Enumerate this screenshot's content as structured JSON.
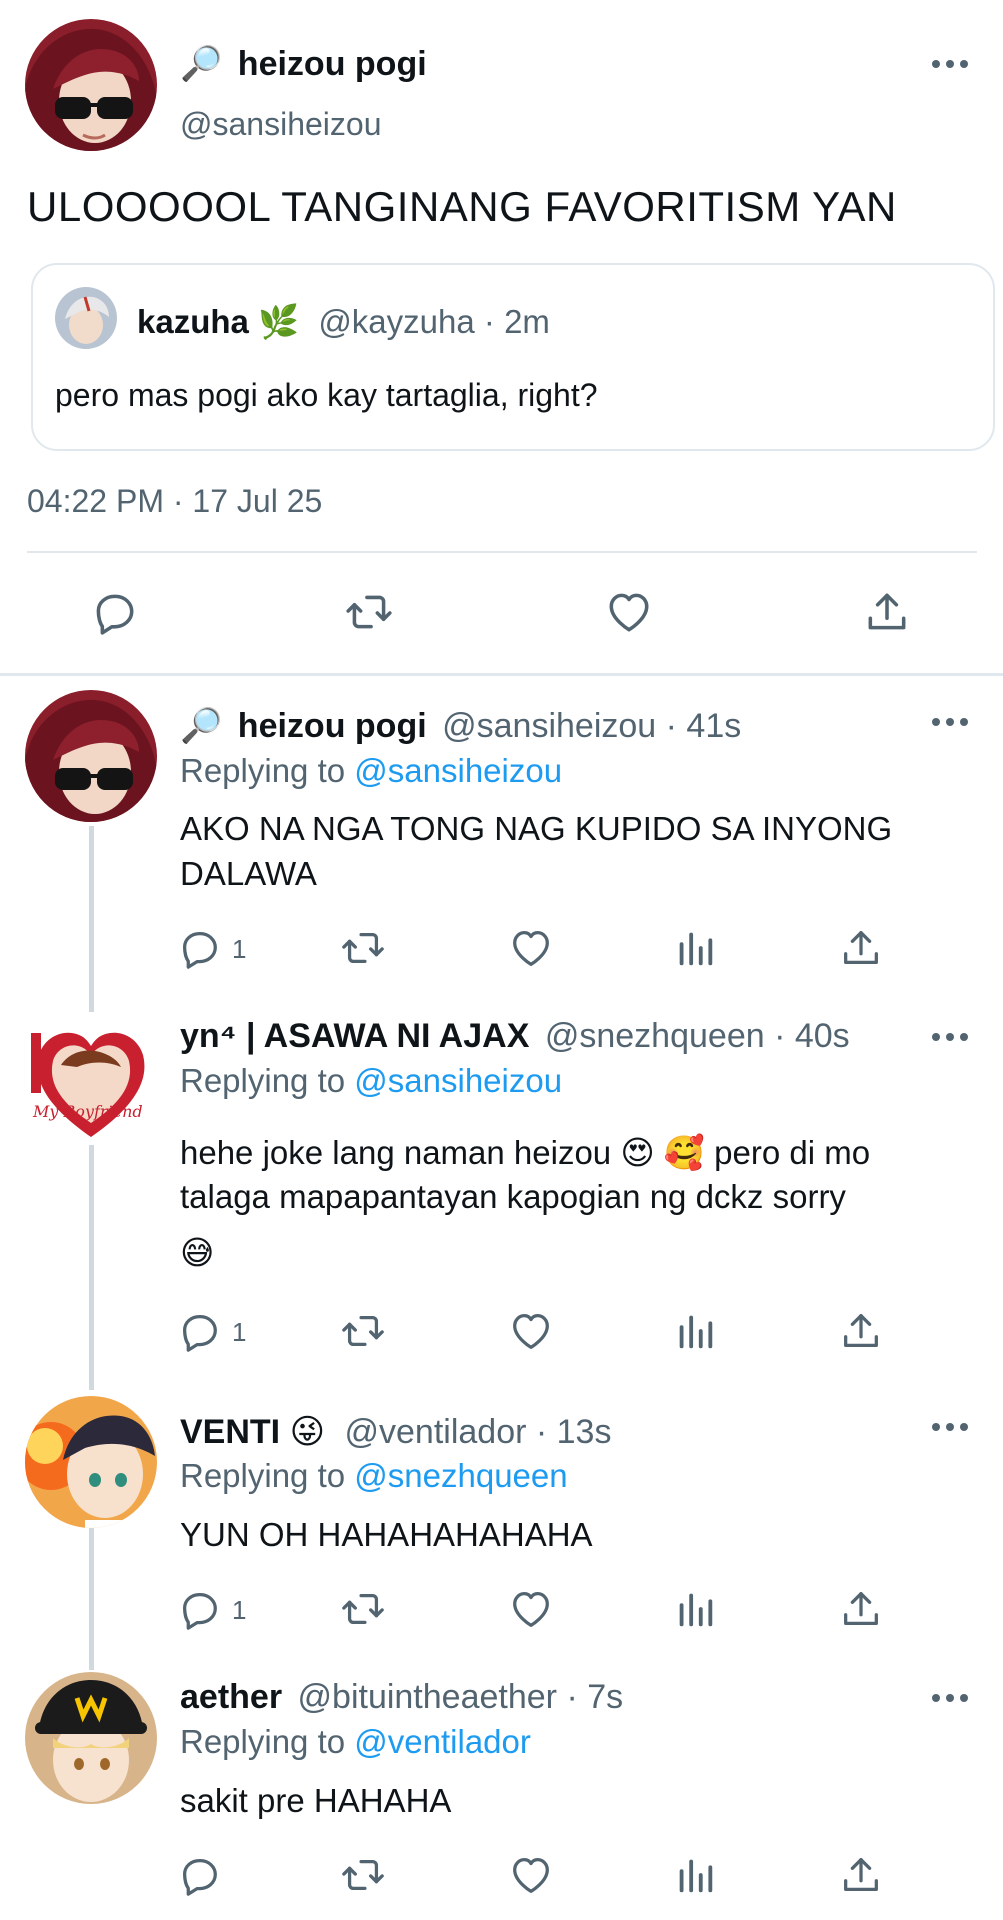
{
  "main_tweet": {
    "name_prefix": "🔎",
    "name": "heizou pogi",
    "handle": "@sansiheizou",
    "text": "ULOOOOOL TANGINANG FAVORITISM YAN",
    "quote": {
      "name": "kazuha",
      "name_suffix": "🌿",
      "handle": "@kayzuha",
      "time": "· 2m",
      "text": "pero mas pogi ako kay tartaglia, right?"
    },
    "timestamp": "04:22 PM · 17 Jul 25",
    "actions": [
      "reply-icon",
      "retweet-icon",
      "like-icon",
      "share-icon"
    ]
  },
  "replies": [
    {
      "name_prefix": "🔎",
      "name": "heizou pogi",
      "handle": "@sansiheizou",
      "time": "· 41s",
      "replying_label": "Replying to",
      "replying_to": "@sansiheizou",
      "text_lines": [
        "AKO NA NGA TONG NAG KUPIDO SA INYONG",
        "DALAWA"
      ],
      "reply_count": "1"
    },
    {
      "name": "yn⁴ | ASAWA NI AJAX",
      "handle": "@snezhqueen",
      "time": "· 40s",
      "replying_label": "Replying to",
      "replying_to": "@sansiheizou",
      "text_lines": [
        "hehe joke lang naman heizou 😍 🥰  pero di mo",
        "talaga mapapantayan kapogian ng dckz sorry",
        "😅"
      ],
      "reply_count": "1"
    },
    {
      "name": "VENTI",
      "name_suffix": "😜",
      "handle": "@ventilador",
      "time": "· 13s",
      "replying_label": "Replying to",
      "replying_to": "@snezhqueen",
      "text_lines": [
        "YUN OH HAHAHAHAHAHA"
      ],
      "reply_count": "1"
    },
    {
      "name": "aether",
      "handle": "@bituintheaether",
      "time": "· 7s",
      "replying_label": "Replying to",
      "replying_to": "@ventilador",
      "text_lines": [
        "sakit pre HAHAHA"
      ],
      "reply_count": ""
    }
  ],
  "icons": {
    "more": "more-icon",
    "reply": "reply-icon",
    "retweet": "retweet-icon",
    "like": "like-icon",
    "views": "views-icon",
    "share": "share-icon"
  },
  "colors": {
    "text": "#0f1419",
    "muted": "#536471",
    "link": "#1d9bf0",
    "divider": "#cfd9de"
  }
}
